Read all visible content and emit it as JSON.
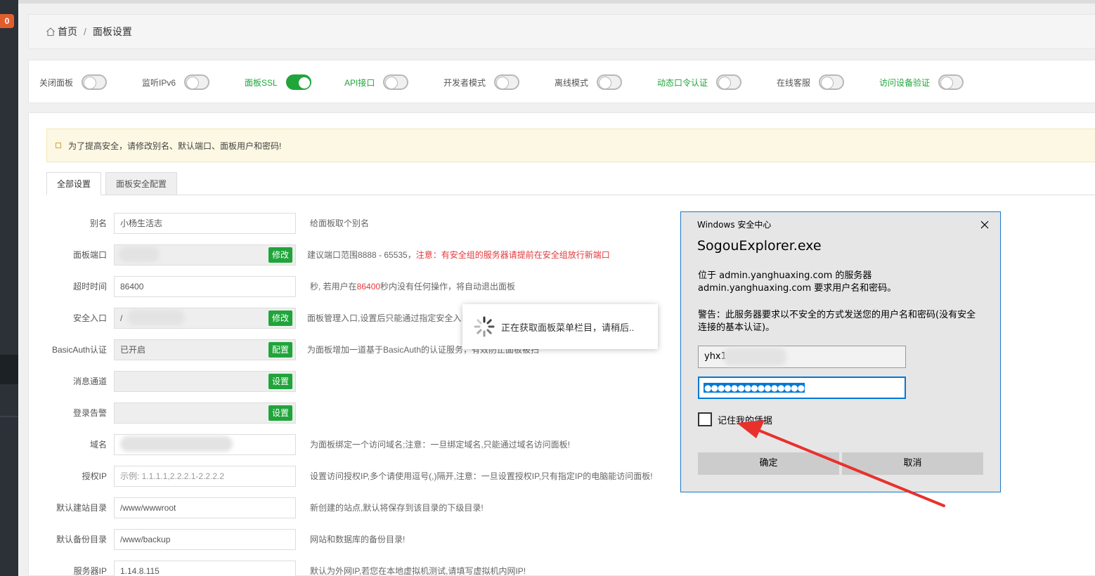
{
  "sidebar": {
    "badge": "0"
  },
  "breadcrumb": {
    "home": "首页",
    "separator": "/",
    "current": "面板设置"
  },
  "switches": [
    {
      "label": "关闭面板",
      "on": false,
      "highlight": false
    },
    {
      "label": "监听IPv6",
      "on": false,
      "highlight": false
    },
    {
      "label": "面板SSL",
      "on": true,
      "highlight": true
    },
    {
      "label": "API接口",
      "on": false,
      "highlight": true
    },
    {
      "label": "开发者模式",
      "on": false,
      "highlight": false
    },
    {
      "label": "离线模式",
      "on": false,
      "highlight": false
    },
    {
      "label": "动态口令认证",
      "on": false,
      "highlight": true
    },
    {
      "label": "在线客服",
      "on": false,
      "highlight": false
    },
    {
      "label": "访问设备验证",
      "on": false,
      "highlight": true
    }
  ],
  "alert": {
    "text": "为了提高安全，请修改别名、默认端口、面板用户和密码!"
  },
  "tabs": [
    "全部设置",
    "面板安全配置"
  ],
  "form": {
    "alias": {
      "label": "别名",
      "value": "小杨生活志",
      "hint": "给面板取个别名"
    },
    "port": {
      "label": "面板端口",
      "value": "",
      "button": "修改",
      "hint_prefix": "建议端口范围8888 - 65535，",
      "hint_warning": "注意：有安全组的服务器请提前在安全组放行新端口"
    },
    "timeout": {
      "label": "超时时间",
      "value": "86400",
      "hint_a": "秒, 若用户在",
      "hint_b": "86400",
      "hint_c": "秒内没有任何操作，将自动退出面板"
    },
    "entrance": {
      "label": "安全入口",
      "value": "/",
      "button": "修改",
      "hint": "面板管理入口,设置后只能通过指定安全入口登录面板"
    },
    "basicauth": {
      "label": "BasicAuth认证",
      "value": "已开启",
      "button": "配置",
      "hint": "为面板增加一道基于BasicAuth的认证服务，有效防止面板被扫"
    },
    "message": {
      "label": "消息通道",
      "value": "",
      "button": "设置"
    },
    "login_alert": {
      "label": "登录告警",
      "value": "",
      "button": "设置"
    },
    "domain": {
      "label": "域名",
      "value": "",
      "hint": "为面板绑定一个访问域名;注意：一旦绑定域名,只能通过域名访问面板!"
    },
    "auth_ip": {
      "label": "授权IP",
      "placeholder": "示例: 1.1.1.1,2.2.2.1-2.2.2.2",
      "hint": "设置访问授权IP,多个请使用逗号(,)隔开,注意：一旦设置授权IP,只有指定IP的电脑能访问面板!"
    },
    "site_dir": {
      "label": "默认建站目录",
      "value": "/www/wwwroot",
      "hint": "新创建的站点,默认将保存到该目录的下级目录!"
    },
    "backup_dir": {
      "label": "默认备份目录",
      "value": "/www/backup",
      "hint": "网站和数据库的备份目录!"
    },
    "server_ip": {
      "label": "服务器IP",
      "value": "1.14.8.115",
      "hint": "默认为外网IP,若您在本地虚拟机测试,请填写虚拟机内网IP!"
    }
  },
  "loading": {
    "text": "正在获取面板菜单栏目，请稍后.."
  },
  "dialog": {
    "caption": "Windows 安全中心",
    "title": "SogouExplorer.exe",
    "message": "位于 admin.yanghuaxing.com 的服务器admin.yanghuaxing.com 要求用户名和密码。",
    "warning": "警告：此服务器要求以不安全的方式发送您的用户名和密码(没有安全连接的基本认证)。",
    "username": "yhx1",
    "password_mask": "●●●●●●●●●●●●●●●",
    "remember_label": "记住我的凭据",
    "ok_label": "确定",
    "cancel_label": "取消"
  },
  "colors": {
    "accent_green": "#20a53a",
    "warning_red": "#e4393c",
    "dialog_border": "#1979ca",
    "annotation_arrow": "#e8312d"
  }
}
